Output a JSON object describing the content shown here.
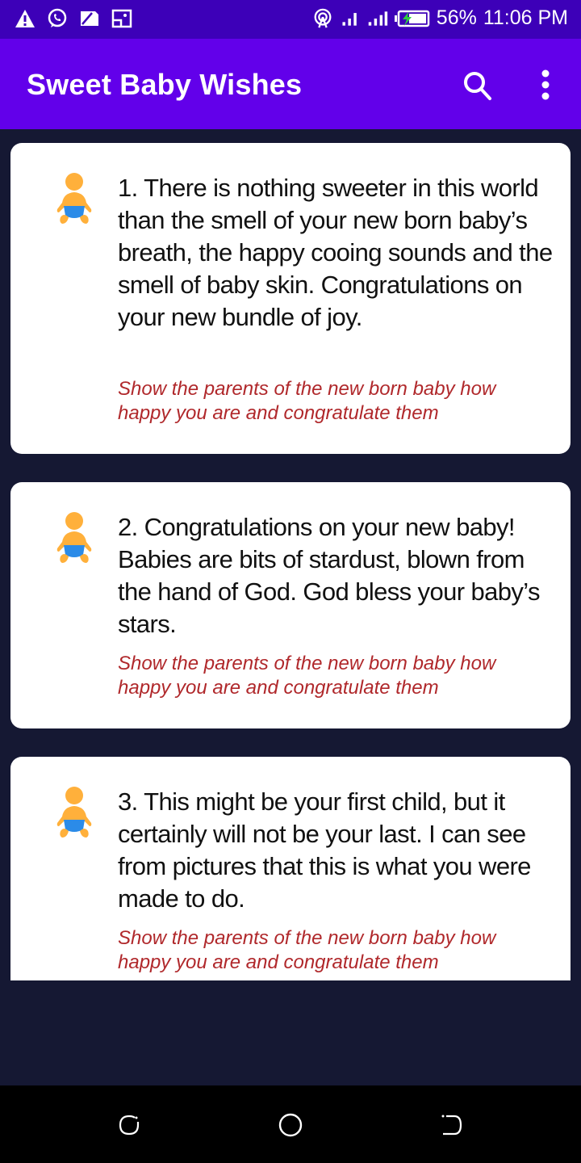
{
  "status_bar": {
    "left_icons": [
      "warning-icon",
      "whatsapp-icon",
      "sim-card-icon",
      "screenshot-icon"
    ],
    "right_icons": [
      "hotspot-icon",
      "signal-icon-1",
      "signal-icon-2",
      "battery-charging-icon"
    ],
    "battery": "56%",
    "time": "11:06 PM"
  },
  "app_bar": {
    "title": "Sweet Baby Wishes",
    "actions": [
      "search-icon",
      "more-vert-icon"
    ]
  },
  "colors": {
    "status_bar": "#3d00b8",
    "app_bar": "#6200ea",
    "background": "#151833",
    "card": "#ffffff",
    "subtitle": "#b0282b",
    "baby_skin": "#ffb03b",
    "diaper": "#2b8be8"
  },
  "wishes": [
    {
      "icon": "baby-icon",
      "text": "1. There is nothing sweeter in this world than the smell of your new born baby’s breath, the happy cooing sounds and the smell of baby skin. Congratulations on your new bundle of joy.",
      "subtitle": "Show the parents of the new born baby how happy you are and congratulate them"
    },
    {
      "icon": "baby-icon",
      "text": "2. Congratulations on your new baby! Babies are bits of stardust, blown from the hand of God. God bless your baby’s stars.",
      "subtitle": "Show the parents of the new born baby how happy you are and congratulate them"
    },
    {
      "icon": "baby-icon",
      "text": "3. This might be your first child, but it certainly will not be your last. I can see from pictures that this is what you were made to do.",
      "subtitle": "Show the parents of the new born baby how happy you are and congratulate them"
    }
  ],
  "nav_bar": [
    "recents-button",
    "home-button",
    "back-button"
  ]
}
